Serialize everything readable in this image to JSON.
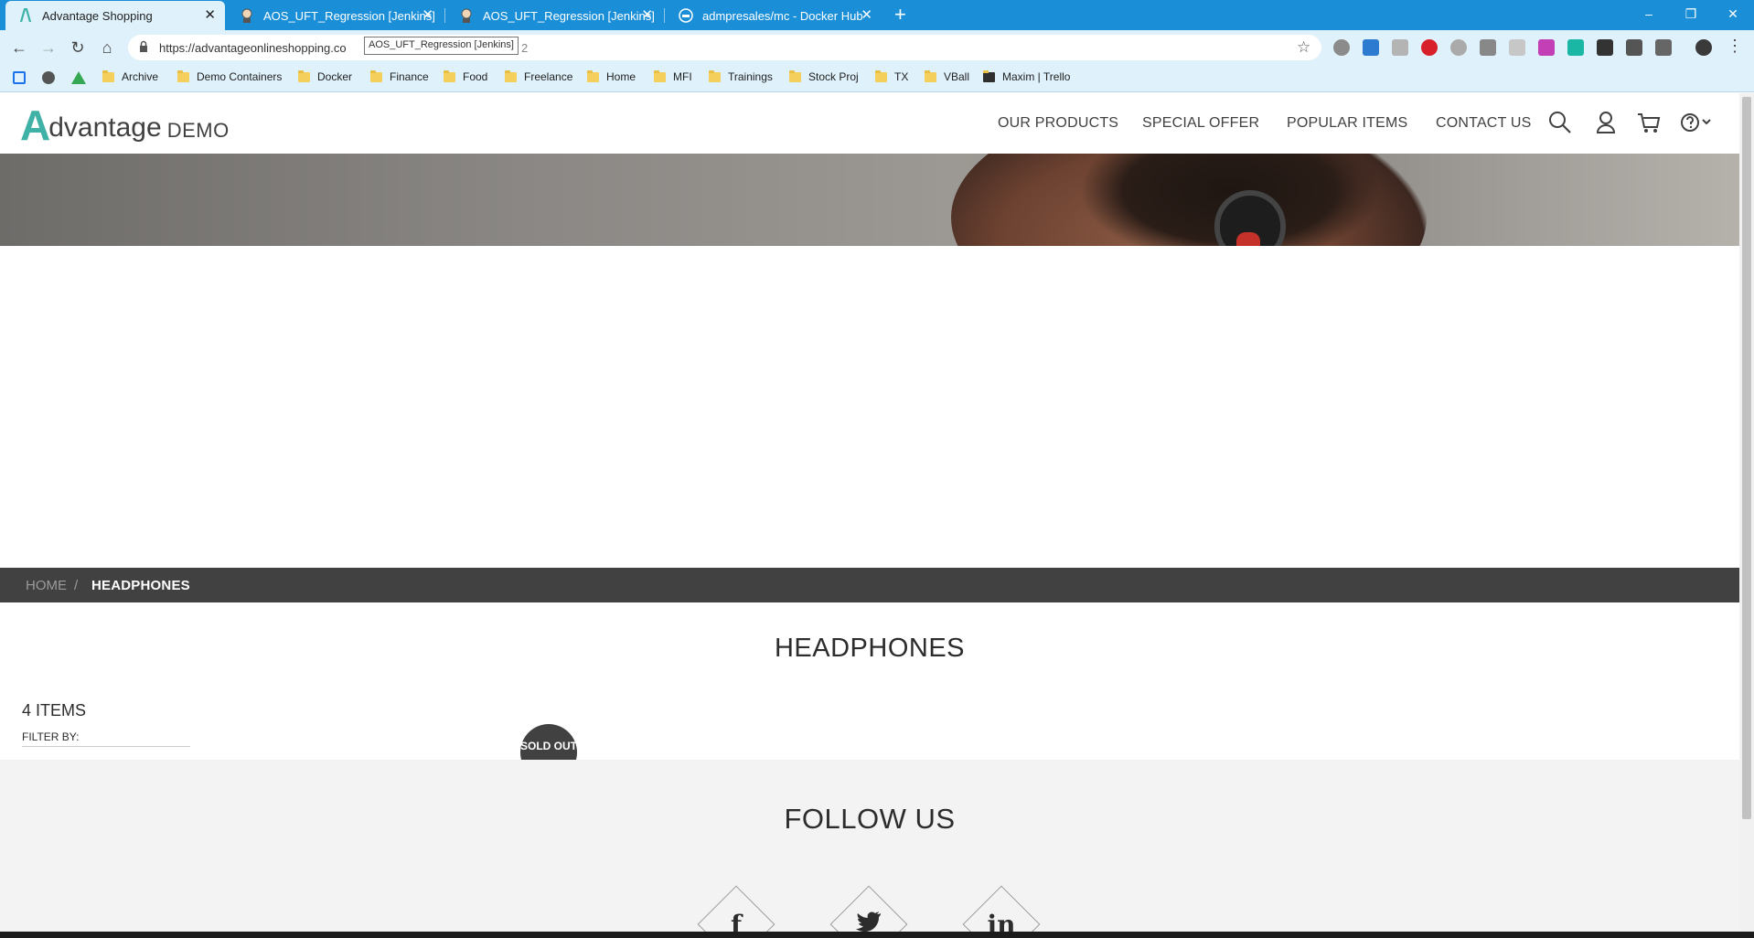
{
  "browser": {
    "tabs": [
      {
        "title": "Advantage Shopping",
        "active": true,
        "icon": "advantage-logo-icon"
      },
      {
        "title": "AOS_UFT_Regression [Jenkins]",
        "active": false,
        "icon": "jenkins-icon"
      },
      {
        "title": "AOS_UFT_Regression [Jenkins]",
        "active": false,
        "icon": "jenkins-icon"
      },
      {
        "title": "admpresales/mc - Docker Hub",
        "active": false,
        "icon": "docker-icon"
      }
    ],
    "new_tab": "+",
    "window_controls": {
      "minimize": "–",
      "restore": "❐",
      "close": "✕"
    },
    "toolbar": {
      "back": "←",
      "forward": "→",
      "reload": "↻",
      "home": "⌂"
    },
    "url_visible": "https://advantageonlineshopping.co",
    "url_tail": "2",
    "tooltip": "AOS_UFT_Regression [Jenkins]",
    "star": "☆",
    "bookmarks": [
      {
        "label": "Archive"
      },
      {
        "label": "Demo Containers"
      },
      {
        "label": "Docker"
      },
      {
        "label": "Finance"
      },
      {
        "label": "Food"
      },
      {
        "label": "Freelance"
      },
      {
        "label": "Home"
      },
      {
        "label": "MFI"
      },
      {
        "label": "Trainings"
      },
      {
        "label": "Stock Proj"
      },
      {
        "label": "TX"
      },
      {
        "label": "VBall"
      },
      {
        "label": "Maxim | Trello"
      }
    ]
  },
  "site": {
    "logo": {
      "letter": "A",
      "brand": "dvantage",
      "demo": "DEMO"
    },
    "menu": [
      "OUR PRODUCTS",
      "SPECIAL OFFER",
      "POPULAR ITEMS",
      "CONTACT US"
    ],
    "header_icons": [
      "search-icon",
      "user-icon",
      "cart-icon",
      "help-icon"
    ],
    "breadcrumb": {
      "home": "HOME",
      "separator": "/",
      "current": "HEADPHONES"
    },
    "category_title": "HEADPHONES",
    "items_count": "4 ITEMS",
    "filter_by": "FILTER BY:",
    "sold_out": "SOLD OUT",
    "footer": {
      "follow_title": "FOLLOW US",
      "social": [
        {
          "name": "facebook",
          "glyph": "f"
        },
        {
          "name": "twitter",
          "glyph": "🐦"
        },
        {
          "name": "linkedin",
          "glyph": "in"
        }
      ]
    }
  },
  "colors": {
    "tab_strip": "#1a8fd8",
    "toolbar": "#dff1fb",
    "logo_accent": "#3fb1a6",
    "dark_gray": "#414141"
  }
}
